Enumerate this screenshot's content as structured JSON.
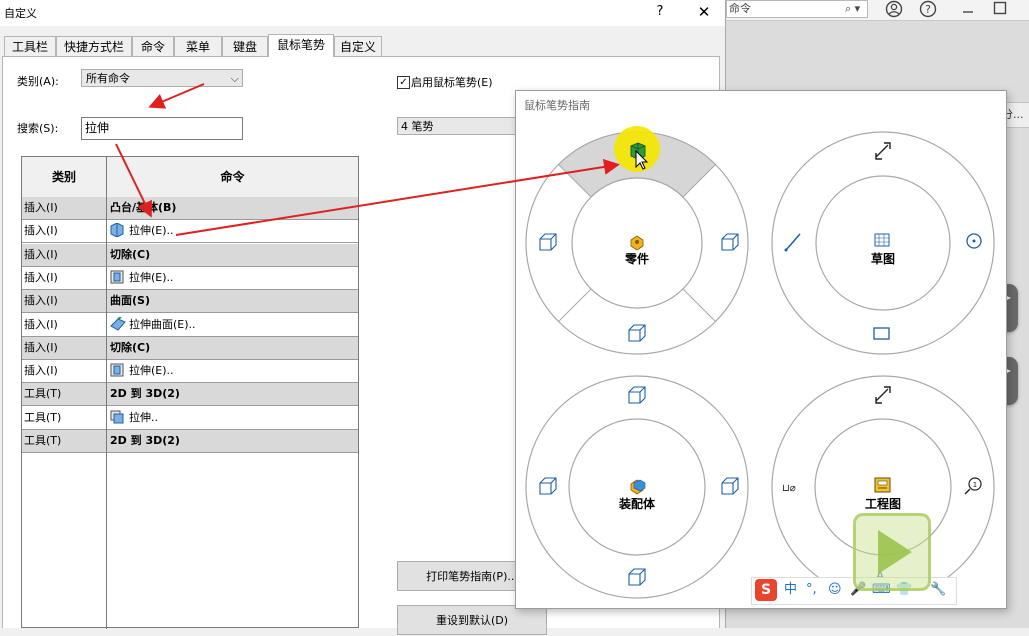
{
  "dialog": {
    "title": "自定义",
    "help": "?",
    "close": "✕"
  },
  "tabs": [
    "工具栏",
    "快捷方式栏",
    "命令",
    "菜单",
    "键盘",
    "鼠标笔势",
    "自定义"
  ],
  "active_tab": "鼠标笔势",
  "category": {
    "label": "类别(A):",
    "value": "所有命令"
  },
  "search": {
    "label": "搜索(S):",
    "value": "拉伸"
  },
  "table": {
    "headers": [
      "类别",
      "命令"
    ],
    "rows": [
      {
        "category": "插入(I)",
        "command": "凸台/基体(B)",
        "group": true,
        "icon": ""
      },
      {
        "category": "插入(I)",
        "command": "拉伸(E)..",
        "group": false,
        "icon": "extrude-boss-icon"
      },
      {
        "category": "插入(I)",
        "command": "切除(C)",
        "group": true,
        "icon": ""
      },
      {
        "category": "插入(I)",
        "command": "拉伸(E)..",
        "group": false,
        "icon": "extrude-cut-icon"
      },
      {
        "category": "插入(I)",
        "command": "曲面(S)",
        "group": true,
        "icon": ""
      },
      {
        "category": "插入(I)",
        "command": "拉伸曲面(E)..",
        "group": false,
        "icon": "extrude-surface-icon"
      },
      {
        "category": "插入(I)",
        "command": "切除(C)",
        "group": true,
        "icon": ""
      },
      {
        "category": "插入(I)",
        "command": "拉伸(E)..",
        "group": false,
        "icon": "extrude-cut-icon"
      },
      {
        "category": "工具(T)",
        "command": "2D 到 3D(2)",
        "group": true,
        "icon": ""
      },
      {
        "category": "工具(T)",
        "command": "拉伸..",
        "group": false,
        "icon": "sketch-extrude-icon"
      },
      {
        "category": "工具(T)",
        "command": "2D 到 3D(2)",
        "group": true,
        "icon": ""
      }
    ]
  },
  "enable_gestures": {
    "label": "启用鼠标笔势(E)",
    "checked": true
  },
  "gesture_count": "4 笔势",
  "buttons": {
    "print_guide": "打印笔势指南(P)...",
    "reset_default": "重设到默认(D)"
  },
  "guide": {
    "title": "鼠标笔势指南",
    "wheels": [
      "零件",
      "草图",
      "装配体",
      "工程图"
    ]
  },
  "background_app": {
    "search_placeholder": "命令",
    "strip_text": "分..."
  },
  "ime": {
    "brand": "S",
    "items": [
      "中",
      "°,",
      "☺",
      "🎤",
      "⌨",
      "👕",
      "🔧"
    ]
  },
  "colors": {
    "accent_red": "#e02020",
    "highlight_yellow": "#f5e600",
    "selected_sector": "#d6d6d6"
  }
}
